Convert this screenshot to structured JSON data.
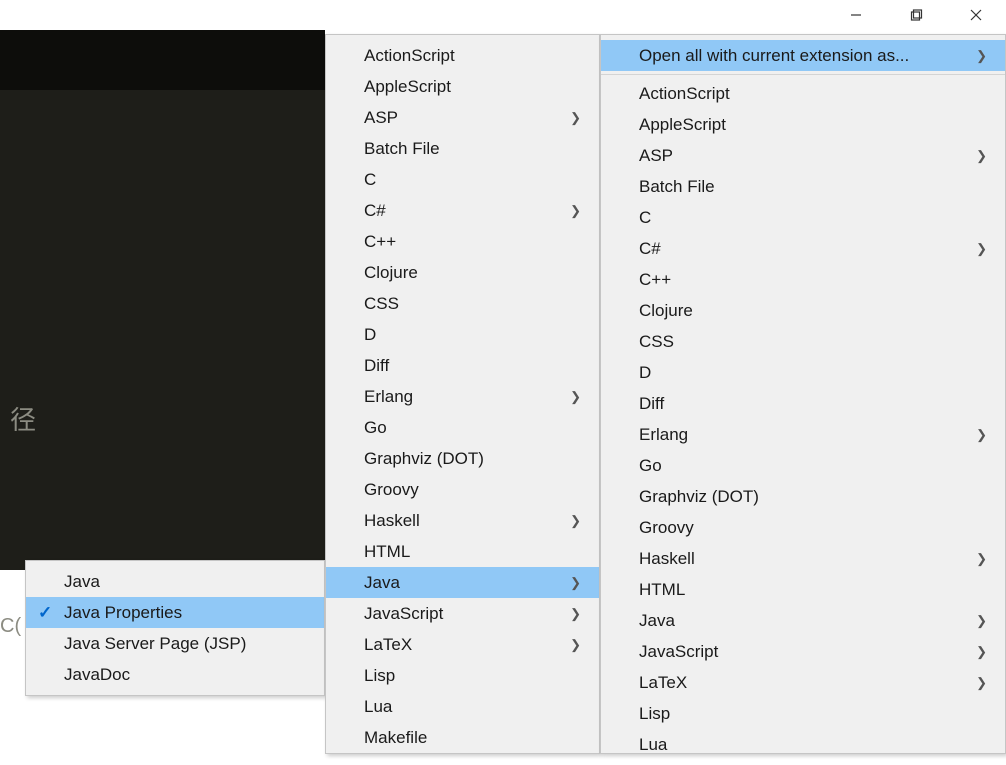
{
  "window_controls": {
    "minimize": "minimize",
    "maximize": "maximize",
    "close": "close"
  },
  "editor": {
    "partial_text1": "径",
    "partial_text2": "C("
  },
  "submenu1": {
    "items": [
      {
        "label": "Java",
        "checked": false,
        "highlighted": false
      },
      {
        "label": "Java Properties",
        "checked": true,
        "highlighted": true
      },
      {
        "label": "Java Server Page (JSP)",
        "checked": false,
        "highlighted": false
      },
      {
        "label": "JavaDoc",
        "checked": false,
        "highlighted": false
      }
    ]
  },
  "submenu2": {
    "items": [
      {
        "label": "ActionScript",
        "submenu": false,
        "highlighted": false
      },
      {
        "label": "AppleScript",
        "submenu": false,
        "highlighted": false
      },
      {
        "label": "ASP",
        "submenu": true,
        "highlighted": false
      },
      {
        "label": "Batch File",
        "submenu": false,
        "highlighted": false
      },
      {
        "label": "C",
        "submenu": false,
        "highlighted": false
      },
      {
        "label": "C#",
        "submenu": true,
        "highlighted": false
      },
      {
        "label": "C++",
        "submenu": false,
        "highlighted": false
      },
      {
        "label": "Clojure",
        "submenu": false,
        "highlighted": false
      },
      {
        "label": "CSS",
        "submenu": false,
        "highlighted": false
      },
      {
        "label": "D",
        "submenu": false,
        "highlighted": false
      },
      {
        "label": "Diff",
        "submenu": false,
        "highlighted": false
      },
      {
        "label": "Erlang",
        "submenu": true,
        "highlighted": false
      },
      {
        "label": "Go",
        "submenu": false,
        "highlighted": false
      },
      {
        "label": "Graphviz (DOT)",
        "submenu": false,
        "highlighted": false
      },
      {
        "label": "Groovy",
        "submenu": false,
        "highlighted": false
      },
      {
        "label": "Haskell",
        "submenu": true,
        "highlighted": false
      },
      {
        "label": "HTML",
        "submenu": false,
        "highlighted": false
      },
      {
        "label": "Java",
        "submenu": true,
        "highlighted": true
      },
      {
        "label": "JavaScript",
        "submenu": true,
        "highlighted": false
      },
      {
        "label": "LaTeX",
        "submenu": true,
        "highlighted": false
      },
      {
        "label": "Lisp",
        "submenu": false,
        "highlighted": false
      },
      {
        "label": "Lua",
        "submenu": false,
        "highlighted": false
      },
      {
        "label": "Makefile",
        "submenu": false,
        "highlighted": false
      }
    ]
  },
  "submenu3": {
    "header": {
      "label": "Open all with current extension as...",
      "submenu": true,
      "highlighted": true
    },
    "items": [
      {
        "label": "ActionScript",
        "submenu": false,
        "highlighted": false
      },
      {
        "label": "AppleScript",
        "submenu": false,
        "highlighted": false
      },
      {
        "label": "ASP",
        "submenu": true,
        "highlighted": false
      },
      {
        "label": "Batch File",
        "submenu": false,
        "highlighted": false
      },
      {
        "label": "C",
        "submenu": false,
        "highlighted": false
      },
      {
        "label": "C#",
        "submenu": true,
        "highlighted": false
      },
      {
        "label": "C++",
        "submenu": false,
        "highlighted": false
      },
      {
        "label": "Clojure",
        "submenu": false,
        "highlighted": false
      },
      {
        "label": "CSS",
        "submenu": false,
        "highlighted": false
      },
      {
        "label": "D",
        "submenu": false,
        "highlighted": false
      },
      {
        "label": "Diff",
        "submenu": false,
        "highlighted": false
      },
      {
        "label": "Erlang",
        "submenu": true,
        "highlighted": false
      },
      {
        "label": "Go",
        "submenu": false,
        "highlighted": false
      },
      {
        "label": "Graphviz (DOT)",
        "submenu": false,
        "highlighted": false
      },
      {
        "label": "Groovy",
        "submenu": false,
        "highlighted": false
      },
      {
        "label": "Haskell",
        "submenu": true,
        "highlighted": false
      },
      {
        "label": "HTML",
        "submenu": false,
        "highlighted": false
      },
      {
        "label": "Java",
        "submenu": true,
        "highlighted": false
      },
      {
        "label": "JavaScript",
        "submenu": true,
        "highlighted": false
      },
      {
        "label": "LaTeX",
        "submenu": true,
        "highlighted": false
      },
      {
        "label": "Lisp",
        "submenu": false,
        "highlighted": false
      },
      {
        "label": "Lua",
        "submenu": false,
        "highlighted": false
      }
    ]
  }
}
